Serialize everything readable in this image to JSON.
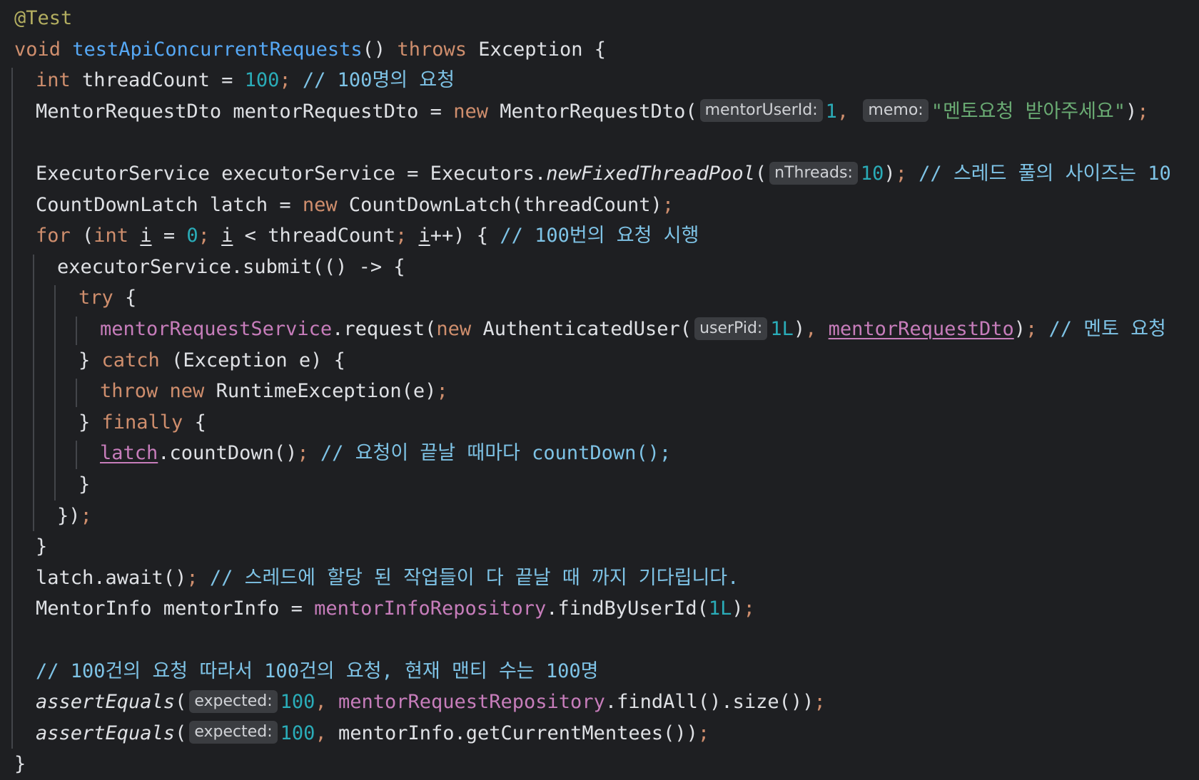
{
  "colors": {
    "background": "#1e1f22",
    "hint_background": "#3b3d41",
    "hint_text": "#d0d2d6",
    "indent_guide": "#43454a"
  },
  "palette": {
    "plain": "#dfe1e5",
    "keyword": "#cf8e6d",
    "annotation": "#b3ae60",
    "method_decl": "#56a8f5",
    "number": "#2aacb8",
    "comment": "#7ec3e6",
    "string": "#6aab73",
    "field": "#c77dbb",
    "param": "#dfe1e5",
    "punct": "#cf8e6d"
  },
  "code": {
    "lines": [
      {
        "indent": 0,
        "tokens": [
          {
            "t": "@Test",
            "c": "annotation"
          }
        ]
      },
      {
        "indent": 0,
        "tokens": [
          {
            "t": "void ",
            "c": "keyword"
          },
          {
            "t": "testApiConcurrentRequests",
            "c": "method_decl"
          },
          {
            "t": "() ",
            "c": "plain"
          },
          {
            "t": "throws ",
            "c": "keyword"
          },
          {
            "t": "Exception {",
            "c": "plain"
          }
        ]
      },
      {
        "indent": 1,
        "tokens": [
          {
            "t": "int ",
            "c": "keyword"
          },
          {
            "t": "threadCount = ",
            "c": "plain"
          },
          {
            "t": "100",
            "c": "number"
          },
          {
            "t": "; ",
            "c": "punct"
          },
          {
            "t": "// 100명의 요청",
            "c": "comment"
          }
        ]
      },
      {
        "indent": 1,
        "tokens": [
          {
            "t": "MentorRequestDto mentorRequestDto = ",
            "c": "plain"
          },
          {
            "t": "new ",
            "c": "keyword"
          },
          {
            "t": "MentorRequestDto(",
            "c": "plain"
          },
          {
            "hint": "mentorUserId:"
          },
          {
            "t": "1",
            "c": "number"
          },
          {
            "t": ", ",
            "c": "punct"
          },
          {
            "hint": "memo:"
          },
          {
            "t": "\"멘토요청 받아주세요\"",
            "c": "string"
          },
          {
            "t": ")",
            "c": "plain"
          },
          {
            "t": ";",
            "c": "punct"
          }
        ]
      },
      {
        "indent": 1,
        "tokens": []
      },
      {
        "indent": 1,
        "tokens": [
          {
            "t": "ExecutorService executorService = Executors.",
            "c": "plain"
          },
          {
            "t": "newFixedThreadPool",
            "c": "plain",
            "i": true
          },
          {
            "t": "(",
            "c": "plain"
          },
          {
            "hint": "nThreads:"
          },
          {
            "t": "10",
            "c": "number"
          },
          {
            "t": ")",
            "c": "plain"
          },
          {
            "t": "; ",
            "c": "punct"
          },
          {
            "t": "// 스레드 풀의 사이즈는 10",
            "c": "comment"
          }
        ]
      },
      {
        "indent": 1,
        "tokens": [
          {
            "t": "CountDownLatch latch = ",
            "c": "plain"
          },
          {
            "t": "new ",
            "c": "keyword"
          },
          {
            "t": "CountDownLatch(threadCount)",
            "c": "plain"
          },
          {
            "t": ";",
            "c": "punct"
          }
        ]
      },
      {
        "indent": 1,
        "tokens": [
          {
            "t": "for ",
            "c": "keyword"
          },
          {
            "t": "(",
            "c": "plain"
          },
          {
            "t": "int ",
            "c": "keyword"
          },
          {
            "t": "i",
            "c": "plain",
            "u": true
          },
          {
            "t": " = ",
            "c": "plain"
          },
          {
            "t": "0",
            "c": "number"
          },
          {
            "t": "; ",
            "c": "punct"
          },
          {
            "t": "i",
            "c": "plain",
            "u": true
          },
          {
            "t": " < threadCount",
            "c": "plain"
          },
          {
            "t": "; ",
            "c": "punct"
          },
          {
            "t": "i",
            "c": "plain",
            "u": true
          },
          {
            "t": "++) { ",
            "c": "plain"
          },
          {
            "t": "// 100번의 요청 시행",
            "c": "comment"
          }
        ]
      },
      {
        "indent": 2,
        "tokens": [
          {
            "t": "executorService.submit(() -> {",
            "c": "plain"
          }
        ]
      },
      {
        "indent": 3,
        "tokens": [
          {
            "t": "try ",
            "c": "keyword"
          },
          {
            "t": "{",
            "c": "plain"
          }
        ]
      },
      {
        "indent": 4,
        "tokens": [
          {
            "t": "mentorRequestService",
            "c": "field"
          },
          {
            "t": ".request(",
            "c": "plain"
          },
          {
            "t": "new ",
            "c": "keyword"
          },
          {
            "t": "AuthenticatedUser(",
            "c": "plain"
          },
          {
            "hint": "userPid:"
          },
          {
            "t": "1L",
            "c": "number"
          },
          {
            "t": ")",
            "c": "plain"
          },
          {
            "t": ", ",
            "c": "punct"
          },
          {
            "t": "mentorRequestDto",
            "c": "field",
            "u": true
          },
          {
            "t": ")",
            "c": "plain"
          },
          {
            "t": "; ",
            "c": "punct"
          },
          {
            "t": "// 멘토 요청",
            "c": "comment"
          }
        ]
      },
      {
        "indent": 3,
        "tokens": [
          {
            "t": "} ",
            "c": "plain"
          },
          {
            "t": "catch ",
            "c": "keyword"
          },
          {
            "t": "(Exception e) {",
            "c": "plain"
          }
        ]
      },
      {
        "indent": 4,
        "tokens": [
          {
            "t": "throw ",
            "c": "keyword"
          },
          {
            "t": "new ",
            "c": "keyword"
          },
          {
            "t": "RuntimeException(e)",
            "c": "plain"
          },
          {
            "t": ";",
            "c": "punct"
          }
        ]
      },
      {
        "indent": 3,
        "tokens": [
          {
            "t": "} ",
            "c": "plain"
          },
          {
            "t": "finally ",
            "c": "keyword"
          },
          {
            "t": "{",
            "c": "plain"
          }
        ]
      },
      {
        "indent": 4,
        "tokens": [
          {
            "t": "latch",
            "c": "field",
            "u": true
          },
          {
            "t": ".countDown()",
            "c": "plain"
          },
          {
            "t": "; ",
            "c": "punct"
          },
          {
            "t": "// 요청이 끝날 때마다 countDown();",
            "c": "comment"
          }
        ]
      },
      {
        "indent": 3,
        "tokens": [
          {
            "t": "}",
            "c": "plain"
          }
        ]
      },
      {
        "indent": 2,
        "tokens": [
          {
            "t": "})",
            "c": "plain"
          },
          {
            "t": ";",
            "c": "punct"
          }
        ]
      },
      {
        "indent": 1,
        "tokens": [
          {
            "t": "}",
            "c": "plain"
          }
        ]
      },
      {
        "indent": 1,
        "tokens": [
          {
            "t": "latch.await()",
            "c": "plain"
          },
          {
            "t": "; ",
            "c": "punct"
          },
          {
            "t": "// 스레드에 할당 된 작업들이 다 끝날 때 까지 기다립니다.",
            "c": "comment"
          }
        ]
      },
      {
        "indent": 1,
        "tokens": [
          {
            "t": "MentorInfo mentorInfo = ",
            "c": "plain"
          },
          {
            "t": "mentorInfoRepository",
            "c": "field"
          },
          {
            "t": ".findByUserId(",
            "c": "plain"
          },
          {
            "t": "1L",
            "c": "number"
          },
          {
            "t": ")",
            "c": "plain"
          },
          {
            "t": ";",
            "c": "punct"
          }
        ]
      },
      {
        "indent": 1,
        "tokens": []
      },
      {
        "indent": 1,
        "tokens": [
          {
            "t": "// 100건의 요청 따라서 100건의 요청, 현재 맨티 수는 100명",
            "c": "comment"
          }
        ]
      },
      {
        "indent": 1,
        "tokens": [
          {
            "t": "assertEquals",
            "c": "plain",
            "i": true
          },
          {
            "t": "(",
            "c": "plain"
          },
          {
            "hint": "expected:"
          },
          {
            "t": "100",
            "c": "number"
          },
          {
            "t": ", ",
            "c": "punct"
          },
          {
            "t": "mentorRequestRepository",
            "c": "field"
          },
          {
            "t": ".findAll().size())",
            "c": "plain"
          },
          {
            "t": ";",
            "c": "punct"
          }
        ]
      },
      {
        "indent": 1,
        "tokens": [
          {
            "t": "assertEquals",
            "c": "plain",
            "i": true
          },
          {
            "t": "(",
            "c": "plain"
          },
          {
            "hint": "expected:"
          },
          {
            "t": "100",
            "c": "number"
          },
          {
            "t": ", ",
            "c": "punct"
          },
          {
            "t": "mentorInfo.getCurrentMentees())",
            "c": "plain"
          },
          {
            "t": ";",
            "c": "punct"
          }
        ]
      },
      {
        "indent": 0,
        "tokens": [
          {
            "t": "}",
            "c": "plain"
          }
        ]
      }
    ]
  }
}
